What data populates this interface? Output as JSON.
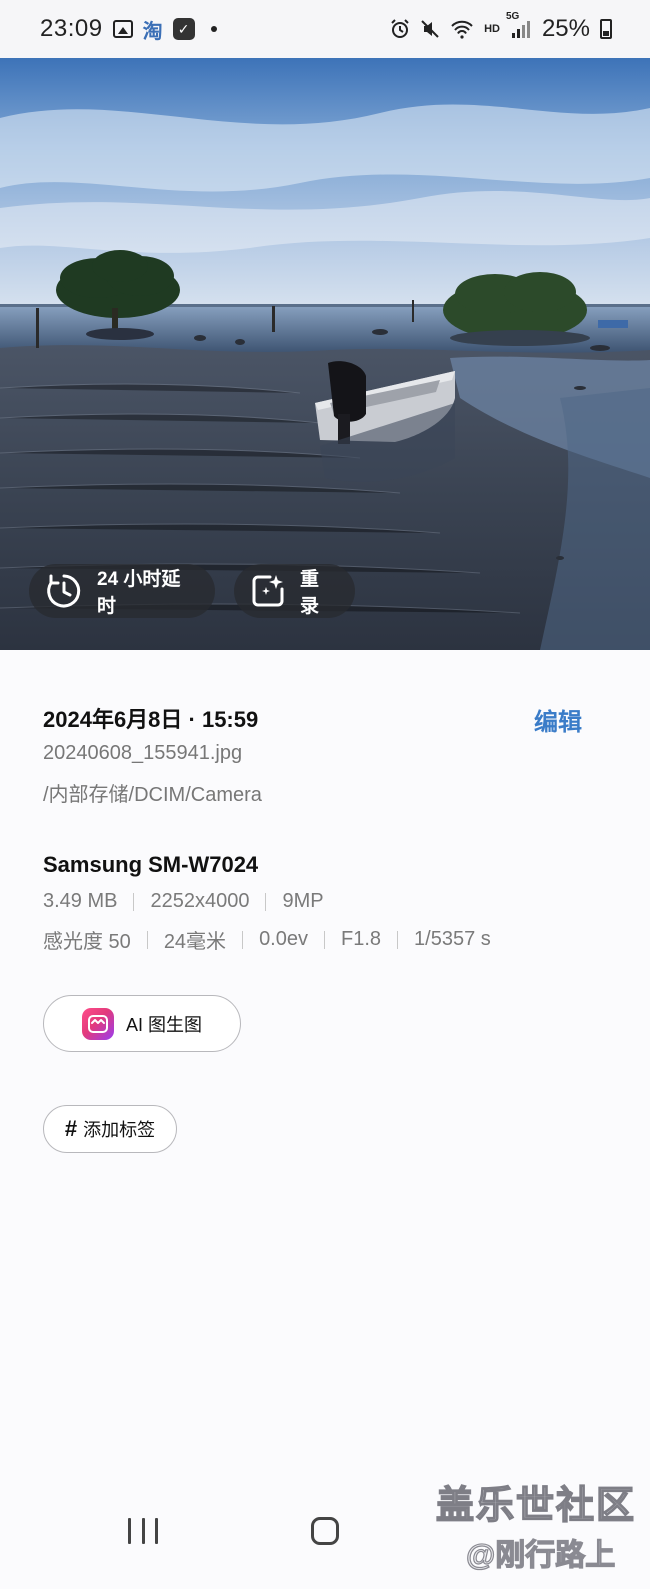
{
  "status_bar": {
    "time": "23:09",
    "taobao_icon_label": "淘",
    "hd_label": "HD",
    "network_label": "5G",
    "battery_percent": "25%",
    "icons": [
      "gallery-icon",
      "taobao-icon",
      "check-app-icon",
      "dot-icon",
      "alarm-icon",
      "mute-icon",
      "wifi-icon",
      "signal-icon",
      "battery-icon"
    ]
  },
  "photo": {
    "buttons": {
      "timelapse_label": "24 小时延时",
      "remaster_label": "重录"
    }
  },
  "details": {
    "date_time": "2024年6月8日 · 15:59",
    "edit_label": "编辑",
    "filename": "20240608_155941.jpg",
    "path": "/内部存储/DCIM/Camera",
    "device": "Samsung SM-W7024",
    "file_size": "3.49 MB",
    "resolution": "2252x4000",
    "megapixels": "9MP",
    "iso": "感光度 50",
    "focal_length": "24毫米",
    "exposure_value": "0.0ev",
    "aperture": "F1.8",
    "shutter_speed": "1/5357 s",
    "ai_button_label": "AI 图生图",
    "tag_button_label": "添加标签",
    "hash_symbol": "#"
  },
  "watermark": {
    "line1": "盖乐世社区",
    "line2": "@刚行路上"
  },
  "colors": {
    "accent": "#3a7cc8",
    "pill_bg": "#2a2c30"
  }
}
